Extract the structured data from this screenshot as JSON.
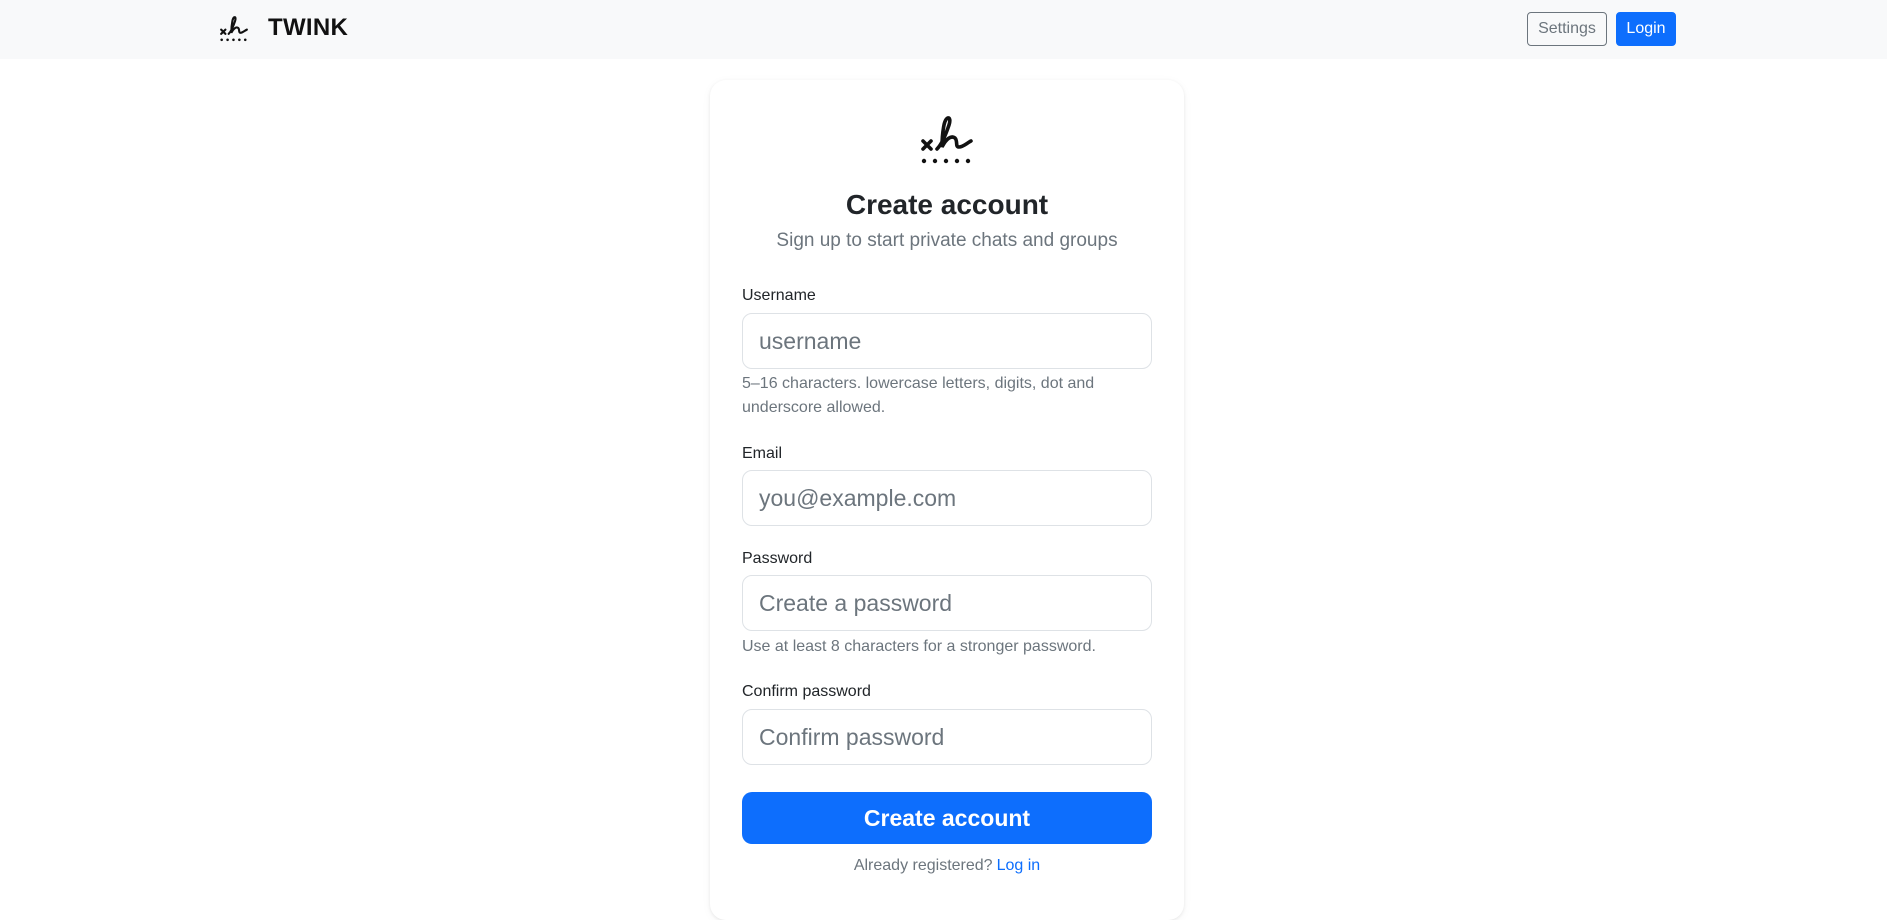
{
  "navbar": {
    "brand_name": "TWINK",
    "brand_logo_icon": "signature-icon",
    "settings_label": "Settings",
    "login_label": "Login"
  },
  "form": {
    "logo_icon": "signature-icon",
    "title": "Create account",
    "subtitle": "Sign up to start private chats and groups",
    "username": {
      "label": "Username",
      "placeholder": "username",
      "value": "",
      "help": "5–16 characters. lowercase letters, digits, dot and underscore allowed."
    },
    "email": {
      "label": "Email",
      "placeholder": "you@example.com",
      "value": ""
    },
    "password": {
      "label": "Password",
      "placeholder": "Create a password",
      "value": "",
      "help": "Use at least 8 characters for a stronger password."
    },
    "confirm_password": {
      "label": "Confirm password",
      "placeholder": "Confirm password",
      "value": ""
    },
    "submit_label": "Create account",
    "footer_text": "Already registered?",
    "footer_link": "Log in"
  },
  "colors": {
    "primary": "#0d6efd",
    "navbar_bg": "#f8f9fa",
    "muted_text": "#6c757d"
  }
}
